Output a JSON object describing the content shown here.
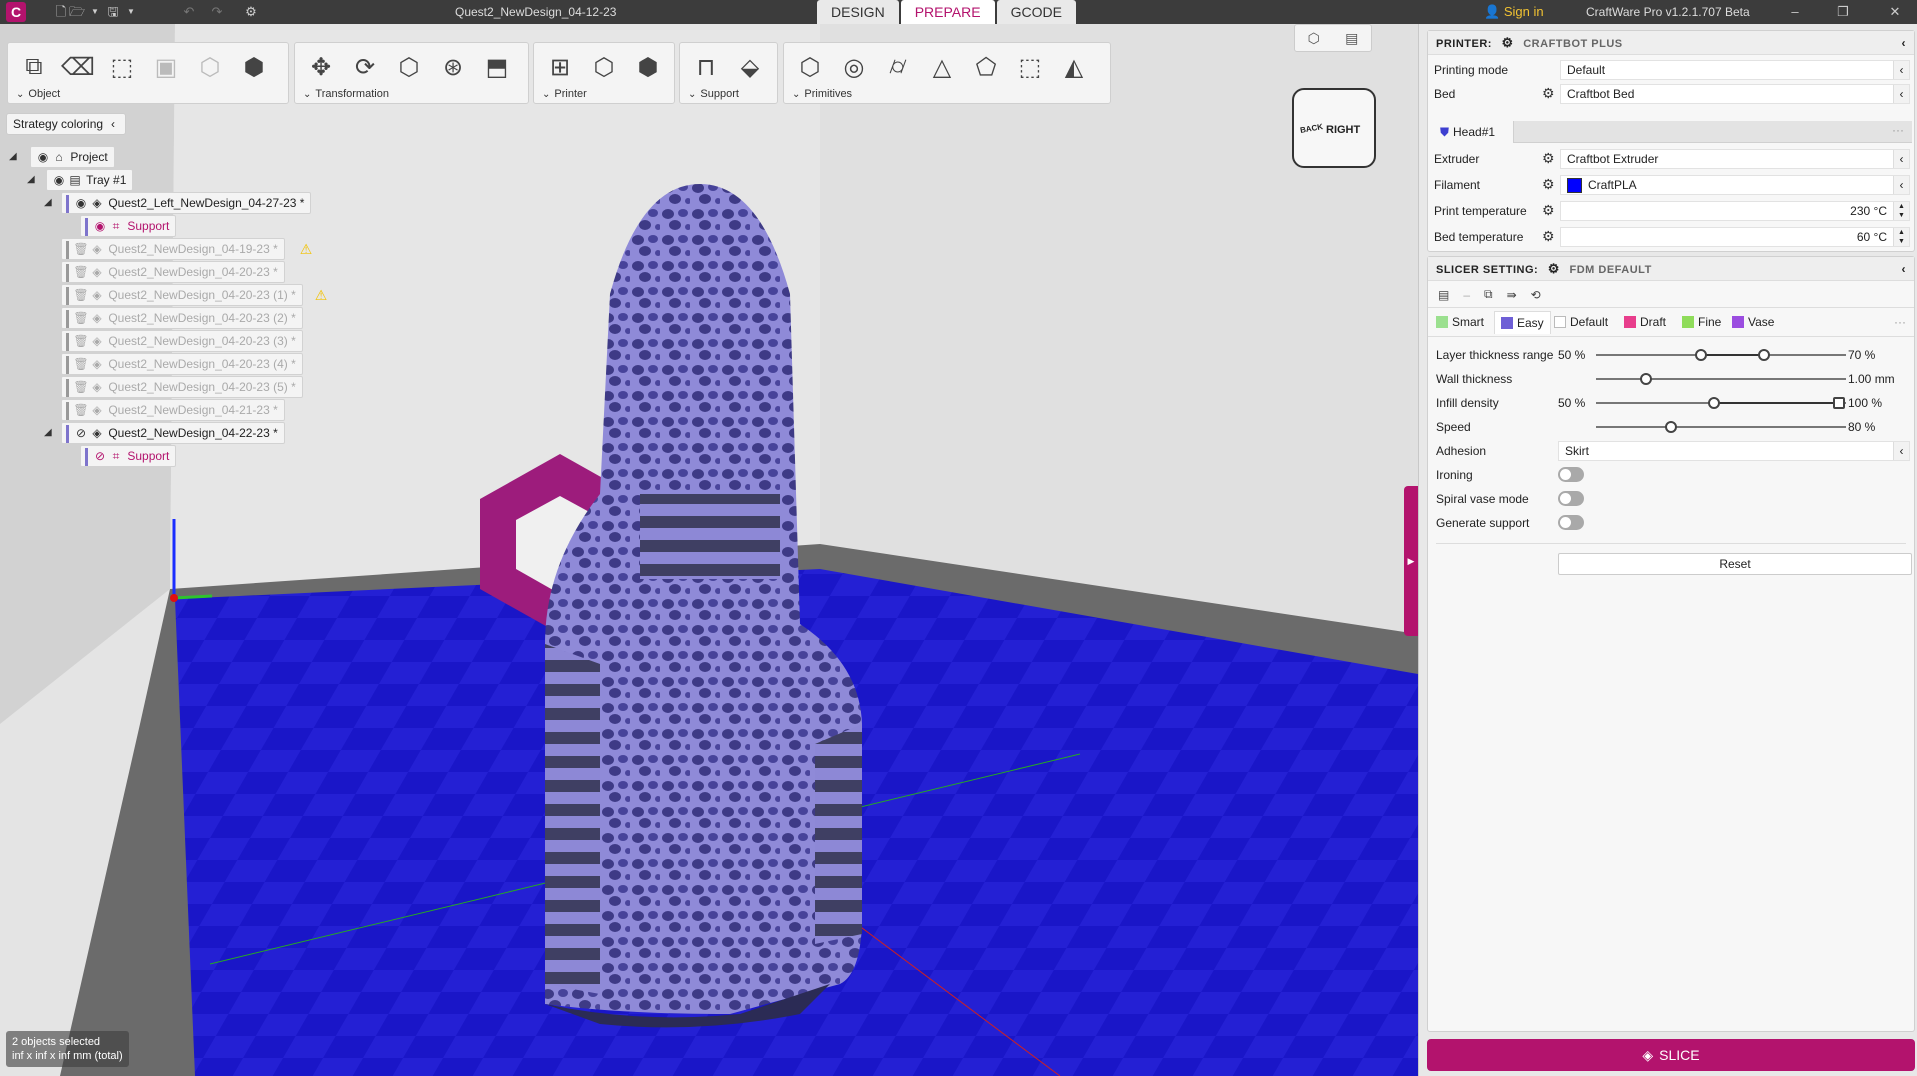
{
  "titlebar": {
    "document_title": "Quest2_NewDesign_04-12-23",
    "tabs": [
      {
        "label": "DESIGN",
        "active": false
      },
      {
        "label": "PREPARE",
        "active": true
      },
      {
        "label": "GCODE",
        "active": false
      }
    ],
    "sign_in": "Sign in",
    "app_version": "CraftWare Pro v1.2.1.707 Beta",
    "logo": "C"
  },
  "toolbar": {
    "groups": [
      {
        "label": "Object"
      },
      {
        "label": "Transformation"
      },
      {
        "label": "Printer"
      },
      {
        "label": "Support"
      },
      {
        "label": "Primitives"
      }
    ]
  },
  "strategy_coloring": {
    "label": "Strategy coloring"
  },
  "tree": {
    "items": [
      {
        "label": "Project",
        "level": 0
      },
      {
        "label": "Tray #1",
        "level": 1
      },
      {
        "label": "Quest2_Left_NewDesign_04-27-23 *",
        "level": 2
      },
      {
        "label": "Support",
        "level": 3
      },
      {
        "label": "Quest2_NewDesign_04-19-23 *",
        "level": 2,
        "warning": true
      },
      {
        "label": "Quest2_NewDesign_04-20-23 *",
        "level": 2
      },
      {
        "label": "Quest2_NewDesign_04-20-23 (1) *",
        "level": 2,
        "warning": true
      },
      {
        "label": "Quest2_NewDesign_04-20-23 (2) *",
        "level": 2
      },
      {
        "label": "Quest2_NewDesign_04-20-23 (3) *",
        "level": 2
      },
      {
        "label": "Quest2_NewDesign_04-20-23 (4) *",
        "level": 2
      },
      {
        "label": "Quest2_NewDesign_04-20-23 (5) *",
        "level": 2
      },
      {
        "label": "Quest2_NewDesign_04-21-23 *",
        "level": 2
      },
      {
        "label": "Quest2_NewDesign_04-22-23 *",
        "level": 2
      },
      {
        "label": "Support",
        "level": 3
      }
    ]
  },
  "view_cube": {
    "face": "RIGHT",
    "side": "BACK"
  },
  "status": {
    "line1": "2 objects selected",
    "line2": "inf x inf x inf mm (total)"
  },
  "printer_panel": {
    "header": "PRINTER:",
    "printer_name": "CRAFTBOT PLUS",
    "printing_mode_label": "Printing mode",
    "printing_mode_value": "Default",
    "bed_label": "Bed",
    "bed_value": "Craftbot Bed",
    "head_tab": "Head#1",
    "extruder_label": "Extruder",
    "extruder_value": "Craftbot Extruder",
    "filament_label": "Filament",
    "filament_value": "CraftPLA",
    "filament_color": "#0000ff",
    "print_temp_label": "Print temperature",
    "print_temp_value": "230 °C",
    "bed_temp_label": "Bed temperature",
    "bed_temp_value": "60 °C"
  },
  "slicer_panel": {
    "header": "SLICER SETTING:",
    "profile_name": "FDM DEFAULT",
    "profiles": [
      {
        "label": "Smart",
        "color": "#9be08f",
        "active": false
      },
      {
        "label": "Easy",
        "color": "#6e5fd6",
        "active": true
      },
      {
        "label": "Default",
        "color": "#ffffff",
        "active": false
      },
      {
        "label": "Draft",
        "color": "#e83e8c",
        "active": false
      },
      {
        "label": "Fine",
        "color": "#8fdc5a",
        "active": false
      },
      {
        "label": "Vase",
        "color": "#9b4de0",
        "active": false
      }
    ],
    "layer_thickness": {
      "label": "Layer thickness range",
      "lo": "50 %",
      "hi": "70 %",
      "value_lo": 0.42,
      "value_hi": 0.67
    },
    "wall_thickness": {
      "label": "Wall thickness",
      "hi": "1.00 mm",
      "value": 0.2
    },
    "infill_density": {
      "label": "Infill density",
      "lo": "50 %",
      "hi": "100 %",
      "value_lo": 0.47,
      "value_hi": 0.97
    },
    "speed": {
      "label": "Speed",
      "hi": "80 %",
      "value": 0.3
    },
    "adhesion": {
      "label": "Adhesion",
      "value": "Skirt"
    },
    "ironing": {
      "label": "Ironing",
      "on": false
    },
    "spiral_vase": {
      "label": "Spiral vase mode",
      "on": false
    },
    "generate_support": {
      "label": "Generate support",
      "on": false
    },
    "reset_label": "Reset"
  },
  "slice_button": "SLICE"
}
